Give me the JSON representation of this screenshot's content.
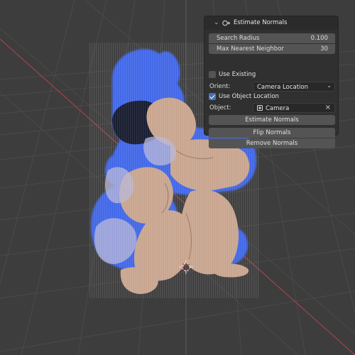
{
  "panel": {
    "title": "Estimate Normals",
    "search_radius": {
      "label": "Search Radius",
      "value": "0.100"
    },
    "max_nearest_neighbor": {
      "label": "Max Nearest Neighbor",
      "value": "30"
    },
    "use_existing": {
      "label": "Use Existing",
      "checked": false
    },
    "orient": {
      "label": "Orient:",
      "value": "Camera Location"
    },
    "use_object_location": {
      "label": "Use Object Location",
      "checked": true
    },
    "object": {
      "label": "Object:",
      "value": "Camera"
    },
    "buttons": {
      "estimate": "Estimate Normals",
      "flip": "Flip Normals",
      "remove": "Remove Normals"
    }
  },
  "colors": {
    "viewport_bg": "#3d3d3d",
    "grid_line": "#4a4a4a",
    "x_axis": "#a04448",
    "y_axis": "#7a9a3e",
    "normals_blue": "#3f66e8",
    "skin": "#c8a48e",
    "accent": "#4772b3"
  },
  "icons": {
    "chevron": "chevron-down-icon",
    "operator": "operator-icon",
    "object": "camera-object-icon",
    "dropdown": "chevron-down-icon",
    "clear": "close-icon",
    "cursor": "3d-cursor-icon"
  }
}
